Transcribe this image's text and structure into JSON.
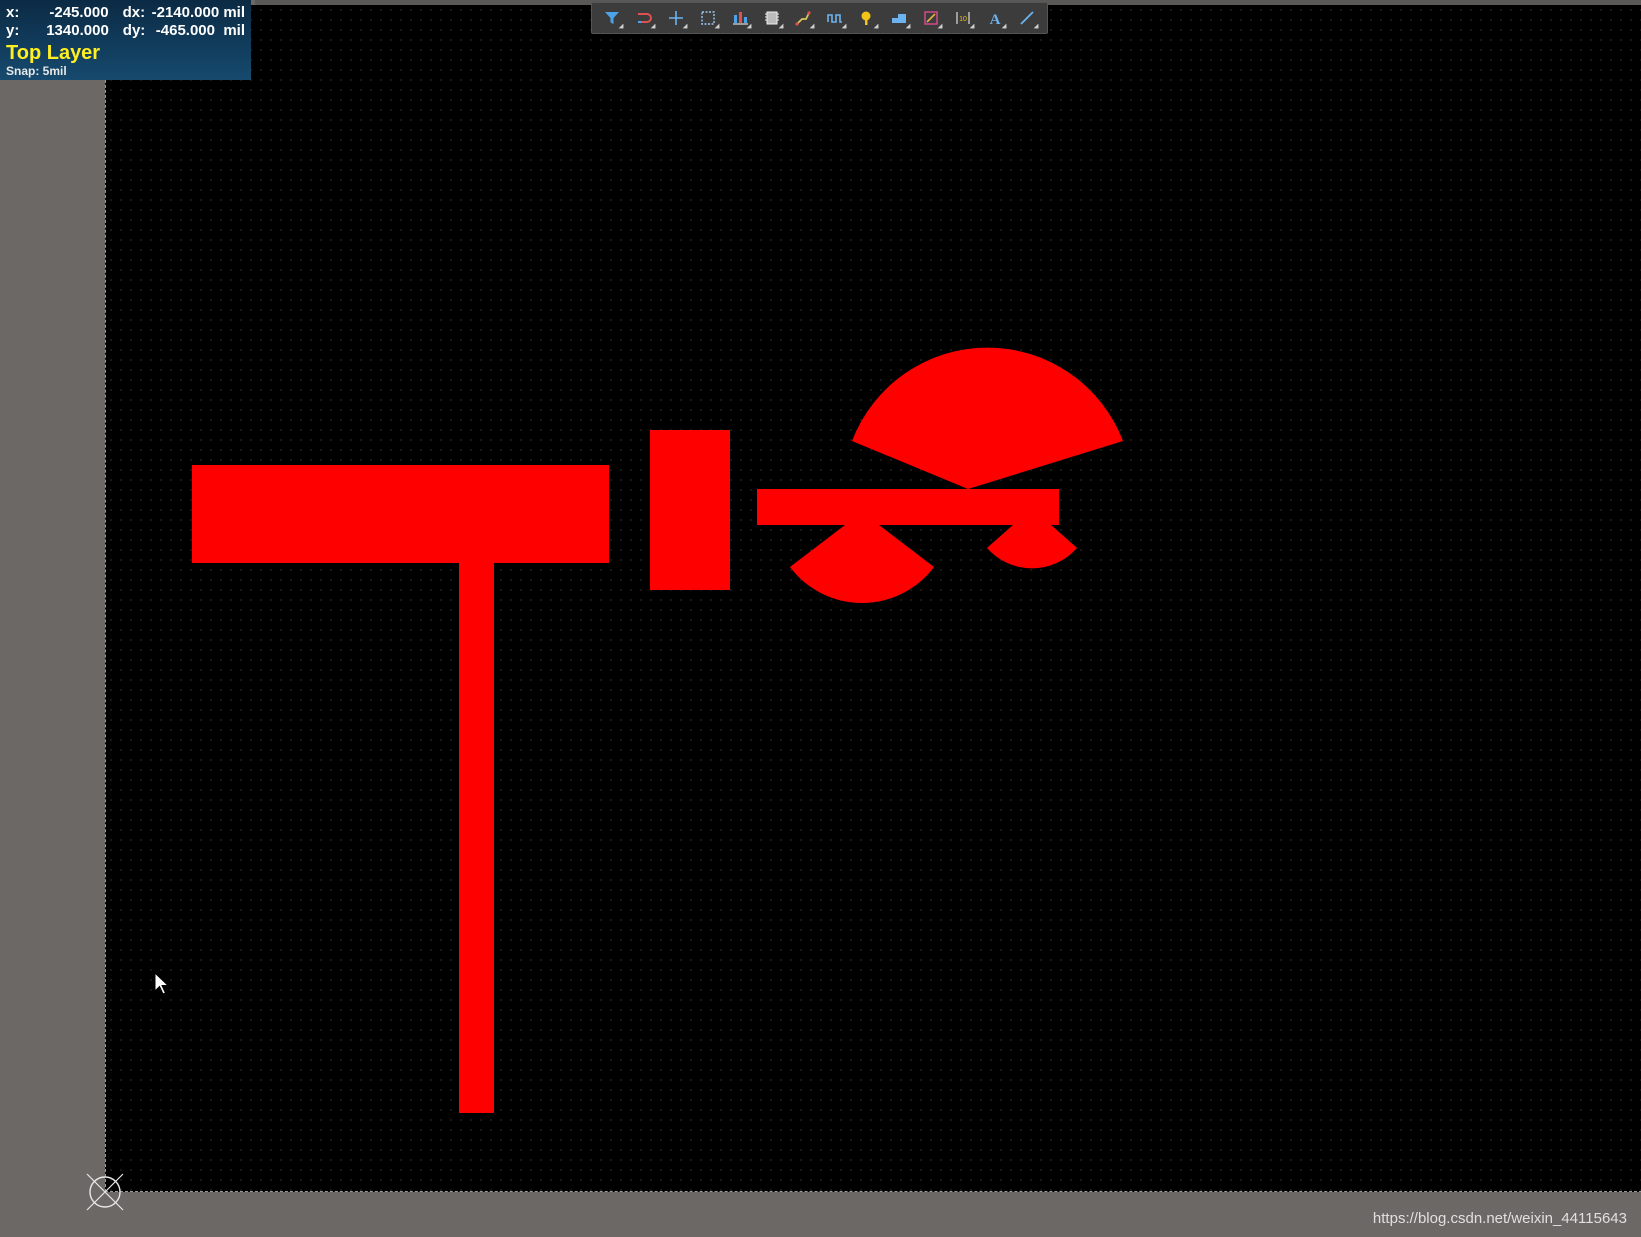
{
  "hud": {
    "x_label": "x:",
    "x_value": "-245.000",
    "y_label": "y:",
    "y_value": "1340.000",
    "dx_label": "dx:",
    "dx_value": "-2140.000 mil",
    "dy_label": "dy:",
    "dy_value": "-465.000  mil",
    "layer": "Top Layer",
    "snap": "Snap: 5mil"
  },
  "toolbar": {
    "tools": [
      {
        "icon": "filter-icon"
      },
      {
        "icon": "interactive-route-icon"
      },
      {
        "icon": "crosshair-icon"
      },
      {
        "icon": "select-rect-icon"
      },
      {
        "icon": "align-icon"
      },
      {
        "icon": "component-icon"
      },
      {
        "icon": "route-icon"
      },
      {
        "icon": "tune-length-icon"
      },
      {
        "icon": "pad-icon"
      },
      {
        "icon": "polygon-icon"
      },
      {
        "icon": "keepout-icon"
      },
      {
        "icon": "dimension-icon"
      },
      {
        "icon": "text-icon"
      },
      {
        "icon": "line-icon"
      }
    ]
  },
  "colors": {
    "copper_top": "#ff0000",
    "board_bg": "#000000",
    "outside_bg": "#6b6866",
    "layer_text": "#ffee22"
  },
  "watermark": "https://blog.csdn.net/weixin_44115643"
}
